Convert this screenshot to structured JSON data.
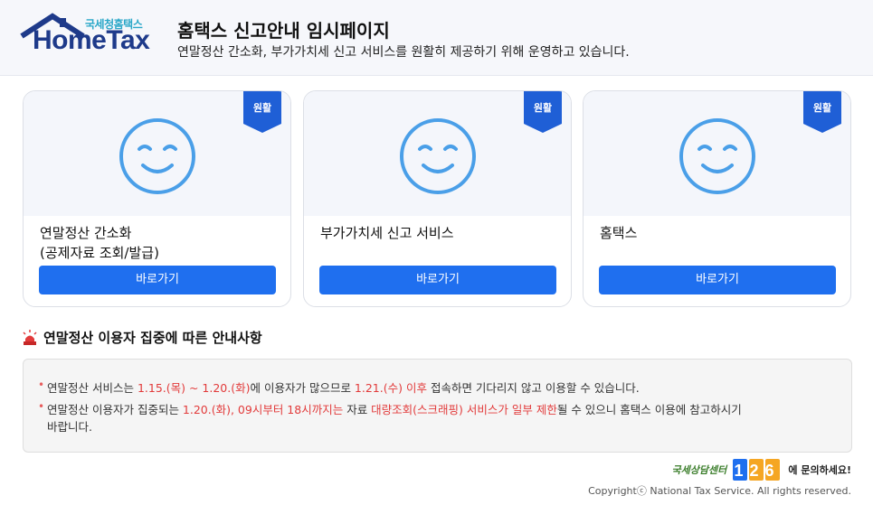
{
  "header": {
    "logo_sub": "국세청홈택스",
    "logo_main": "HomeTax",
    "title": "홈택스 신고안내 임시페이지",
    "subtitle": "연말정산 간소화, 부가가치세 신고 서비스를 원활히 제공하기 위해 운영하고 있습니다."
  },
  "cards": [
    {
      "status": "원활",
      "title_line1": "연말정산 간소화",
      "title_line2": "(공제자료 조회/발급)",
      "button": "바로가기"
    },
    {
      "status": "원활",
      "title_line1": "부가가치세 신고 서비스",
      "title_line2": "",
      "button": "바로가기"
    },
    {
      "status": "원활",
      "title_line1": "홈택스",
      "title_line2": "",
      "button": "바로가기"
    }
  ],
  "notice": {
    "title": "연말정산 이용자 집중에 따른 안내사항",
    "line1": {
      "p1": "연말정산 서비스는 ",
      "r1": "1.15.(목) ~ 1.20.(화)",
      "p2": "에 이용자가 많으므로 ",
      "r2": "1.21.(수) 이후",
      "p3": " 접속하면 기다리지 않고 이용할 수 있습니다."
    },
    "line2": {
      "p1": "연말정산 이용자가 집중되는 ",
      "r1": "1.20.(화), 09시부터 18시까지는",
      "p2": " 자료 ",
      "r2": "대량조회(스크래핑) 서비스가 일부 제한",
      "p3": "될 수 있으니 홈택스 이용에 참고하시기",
      "p4": "바랍니다."
    }
  },
  "footer": {
    "cs_left": "국세상담센터",
    "cs_number": "126",
    "cs_right": "에 문의하세요!",
    "copyright": "Copyrightⓒ National Tax Service. All rights reserved."
  },
  "colors": {
    "accent": "#1f6fef",
    "badge": "#1f5fd6",
    "smile": "#4a9fe8",
    "highlight": "#e23b3b"
  }
}
